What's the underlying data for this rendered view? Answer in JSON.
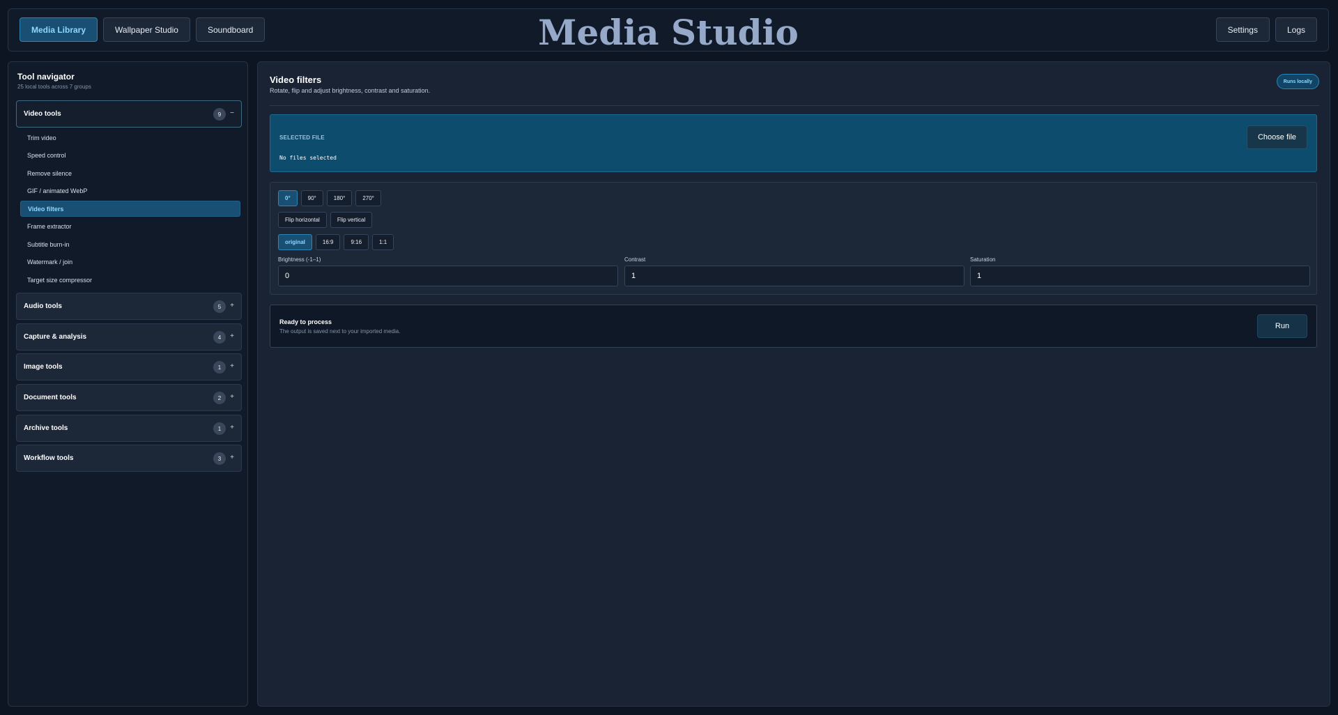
{
  "header": {
    "brand": "Media Studio",
    "nav_left": [
      "Media Library",
      "Wallpaper Studio",
      "Soundboard"
    ],
    "nav_right": [
      "Settings",
      "Logs"
    ],
    "active_nav": "Media Library"
  },
  "sidebar": {
    "title": "Tool navigator",
    "subtitle": "25 local tools across 7 groups",
    "groups": [
      {
        "label": "Video tools",
        "count": "9",
        "toggle": "−",
        "expanded": true
      },
      {
        "label": "Audio tools",
        "count": "5",
        "toggle": "+"
      },
      {
        "label": "Capture & analysis",
        "count": "4",
        "toggle": "+"
      },
      {
        "label": "Image tools",
        "count": "1",
        "toggle": "+"
      },
      {
        "label": "Document tools",
        "count": "2",
        "toggle": "+"
      },
      {
        "label": "Archive tools",
        "count": "1",
        "toggle": "+"
      },
      {
        "label": "Workflow tools",
        "count": "3",
        "toggle": "+"
      }
    ],
    "video_tools": [
      "Trim video",
      "Speed control",
      "Remove silence",
      "GIF / animated WebP",
      "Video filters",
      "Frame extractor",
      "Subtitle burn-in",
      "Watermark / join",
      "Target size compressor"
    ],
    "active_tool": "Video filters"
  },
  "main": {
    "title": "Video filters",
    "subtitle": "Rotate, flip and adjust brightness, contrast and saturation.",
    "badge": "Runs locally",
    "file": {
      "label": "SELECTED FILE",
      "value": "No files selected",
      "choose_label": "Choose file"
    },
    "rotation": {
      "options": [
        "0°",
        "90°",
        "180°",
        "270°"
      ],
      "selected": "0°"
    },
    "flip": {
      "options": [
        "Flip horizontal",
        "Flip vertical"
      ]
    },
    "aspect": {
      "options": [
        "original",
        "16:9",
        "9:16",
        "1:1"
      ],
      "selected": "original"
    },
    "fields": [
      {
        "label": "Brightness (-1–1)",
        "value": "0"
      },
      {
        "label": "Contrast",
        "value": "1"
      },
      {
        "label": "Saturation",
        "value": "1"
      }
    ],
    "run": {
      "title": "Ready to process",
      "subtitle": "The output is saved next to your imported media.",
      "button": "Run"
    }
  },
  "colors": {
    "background": "#0e1522",
    "panel": "#192334",
    "accent": "#1a4f74",
    "accent_text": "#8fd7ff",
    "brand_text": "#96a9c9"
  }
}
